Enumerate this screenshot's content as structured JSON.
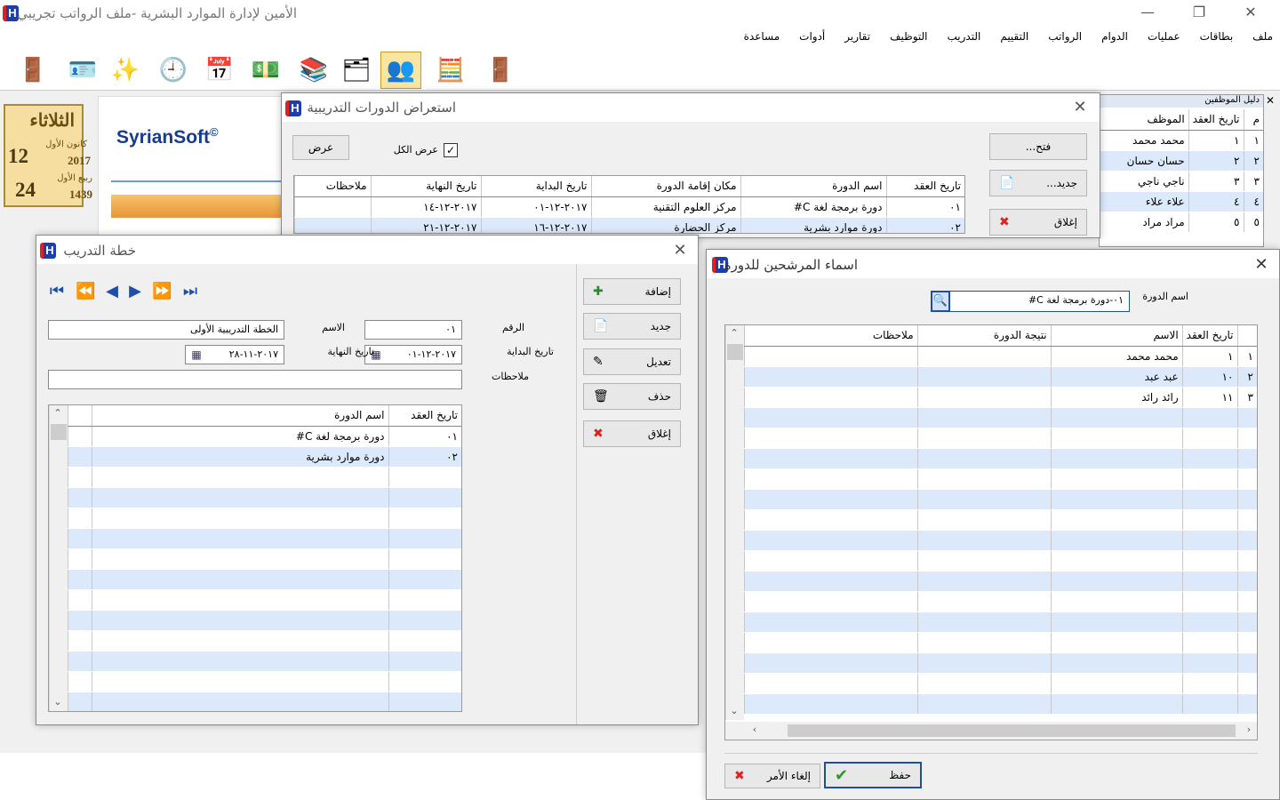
{
  "app": {
    "title": "الأمين لإدارة الموارد البشرية -ملف الرواتب تجريبي",
    "icon": "app-logo-icon"
  },
  "menu": [
    "ملف",
    "بطاقات",
    "عمليات",
    "الدوام",
    "الرواتب",
    "التقييم",
    "التدريب",
    "التوظيف",
    "تقارير",
    "أدوات",
    "مساعدة"
  ],
  "toolbar": [
    "door-enter-icon",
    "employee-card-icon",
    "wand-icon",
    "clock-icon",
    "calendar-clock-icon",
    "money-icon",
    "book-stack-icon",
    "documents-icon",
    "training-users-icon",
    "calculator-icon",
    "exit-door-icon"
  ],
  "date": {
    "day": "الثلاثاء",
    "greg_day": "12",
    "greg_month": "كانون الأول",
    "greg_year": "2017",
    "hij_day": "24",
    "hij_month": "ربيع الأول",
    "hij_year": "1439"
  },
  "logo": {
    "text": "SyrianSoft",
    "mark": "©"
  },
  "employees": {
    "title": "دليل الموظفين",
    "headers": [
      "م",
      "تاريخ العقد",
      "الموظف"
    ],
    "rows": [
      [
        "١",
        "١",
        "محمد محمد"
      ],
      [
        "٢",
        "٢",
        "حسان حسان"
      ],
      [
        "٣",
        "٣",
        "ناجي ناجي"
      ],
      [
        "٤",
        "٤",
        "علاء علاء"
      ],
      [
        "٥",
        "٥",
        "مراد مراد"
      ]
    ]
  },
  "courses": {
    "title": "استعراض الدورات التدريبية",
    "show_btn": "عرض",
    "show_all": "عرض الكل",
    "open_btn": "فتح...",
    "new_btn": "جديد...",
    "close_btn": "إغلاق",
    "headers": [
      "تاريخ العقد",
      "اسم الدورة",
      "مكان إقامة الدورة",
      "تاريخ البداية",
      "تاريخ النهاية",
      "ملاحظات"
    ],
    "rows": [
      [
        "٠١",
        "دورة برمجة لغة C#",
        "مركز العلوم التقنية",
        "٢٠١٧-١٢-٠١",
        "٢٠١٧-١٢-١٤",
        ""
      ],
      [
        "٠٢",
        "دورة موارد بشرية",
        "مركز الحضارة",
        "٢٠١٧-١٢-١٦",
        "٢٠١٧-١٢-٢١",
        ""
      ]
    ]
  },
  "plan": {
    "title": "خطة التدريب",
    "num_label": "الرقم",
    "num_value": "٠١",
    "name_label": "الاسم",
    "name_value": "الخطة التدريبية الأولى",
    "start_label": "تاريخ البداية",
    "start_value": "٢٠١٧-١٢-٠١",
    "end_label": "تاريخ النهاية",
    "end_value": "٢٠١٧-١١-٢٨",
    "notes_label": "ملاحظات",
    "notes_value": "",
    "add_btn": "إضافة",
    "new_btn": "جديد",
    "edit_btn": "تعديل",
    "del_btn": "حذف",
    "close_btn": "إغلاق",
    "headers": [
      "تاريخ العقد",
      "اسم الدورة",
      ""
    ],
    "rows": [
      [
        "٠١",
        "دورة برمجة لغة C#",
        ""
      ],
      [
        "٠٢",
        "دورة موارد بشرية",
        ""
      ]
    ]
  },
  "candidates": {
    "title": "اسماء المرشحين للدورة",
    "course_label": "اسم الدورة",
    "course_value": "٠١-دورة برمجة لغة C#",
    "headers": [
      "",
      "تاريخ العقد",
      "الاسم",
      "نتيجة الدورة",
      "ملاحظات"
    ],
    "rows": [
      [
        "١",
        "١",
        "محمد محمد",
        "",
        ""
      ],
      [
        "٢",
        "١٠",
        "عبد عبد",
        "",
        ""
      ],
      [
        "٣",
        "١١",
        "رائد رائد",
        "",
        ""
      ]
    ],
    "save_btn": "حفظ",
    "cancel_btn": "إلغاء الأمر"
  }
}
